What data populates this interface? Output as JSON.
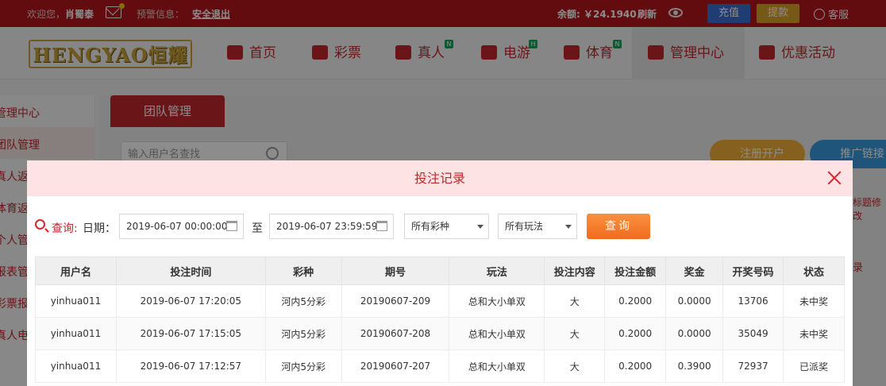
{
  "topbar": {
    "welcome": "欢迎您，",
    "username": "肖蜀泰",
    "warning_label": "预警信息：",
    "logout": "安全退出",
    "balance_label": "余额: ￥24.1940",
    "refresh": "刷新",
    "recharge": "充值",
    "withdraw": "提款",
    "service": "客服"
  },
  "logo": {
    "text": "HENGYAO恒耀"
  },
  "nav": {
    "home": "首页",
    "lottery": "彩票",
    "live": "真人",
    "egame": "电游",
    "sports": "体育",
    "manage": "管理中心",
    "promo": "优惠活动",
    "badge_n": "N",
    "badge_h": "H"
  },
  "sidebar": {
    "items": [
      "管理中心",
      "团队管理",
      "真人返",
      "体育返",
      "个人管",
      "报表管",
      "彩票报",
      "真人电"
    ]
  },
  "background": {
    "tab": "团队管理",
    "search_placeholder": "输入用户名查找",
    "register": "注册开户",
    "promote": "推广链接",
    "side_text_1": "标题修改",
    "side_text_2": "录"
  },
  "modal": {
    "title": "投注记录",
    "query_label": "查询:",
    "date_label": "日期：",
    "start_date": "2019-06-07 00:00:00",
    "to_label": "至",
    "end_date": "2019-06-07 23:59:59",
    "lottery_select": "所有彩种",
    "play_select": "所有玩法",
    "query_button": "查询"
  },
  "table": {
    "headers": [
      "用户名",
      "投注时间",
      "彩种",
      "期号",
      "玩法",
      "投注内容",
      "投注金额",
      "奖金",
      "开奖号码",
      "状态"
    ],
    "rows": [
      [
        "yinhua011",
        "2019-06-07 17:20:05",
        "河内5分彩",
        "20190607-209",
        "总和大小单双",
        "大",
        "0.2000",
        "0.0000",
        "13706",
        "未中奖"
      ],
      [
        "yinhua011",
        "2019-06-07 17:15:05",
        "河内5分彩",
        "20190607-208",
        "总和大小单双",
        "大",
        "0.2000",
        "0.0000",
        "35049",
        "未中奖"
      ],
      [
        "yinhua011",
        "2019-06-07 17:12:57",
        "河内5分彩",
        "20190607-207",
        "总和大小单双",
        "大",
        "0.2000",
        "0.3900",
        "72937",
        "已派奖"
      ]
    ]
  },
  "colors": {
    "brand_red": "#b3161d",
    "accent_orange": "#f26a1e",
    "paid_red": "#d9262c",
    "lose_gray": "#999999"
  }
}
